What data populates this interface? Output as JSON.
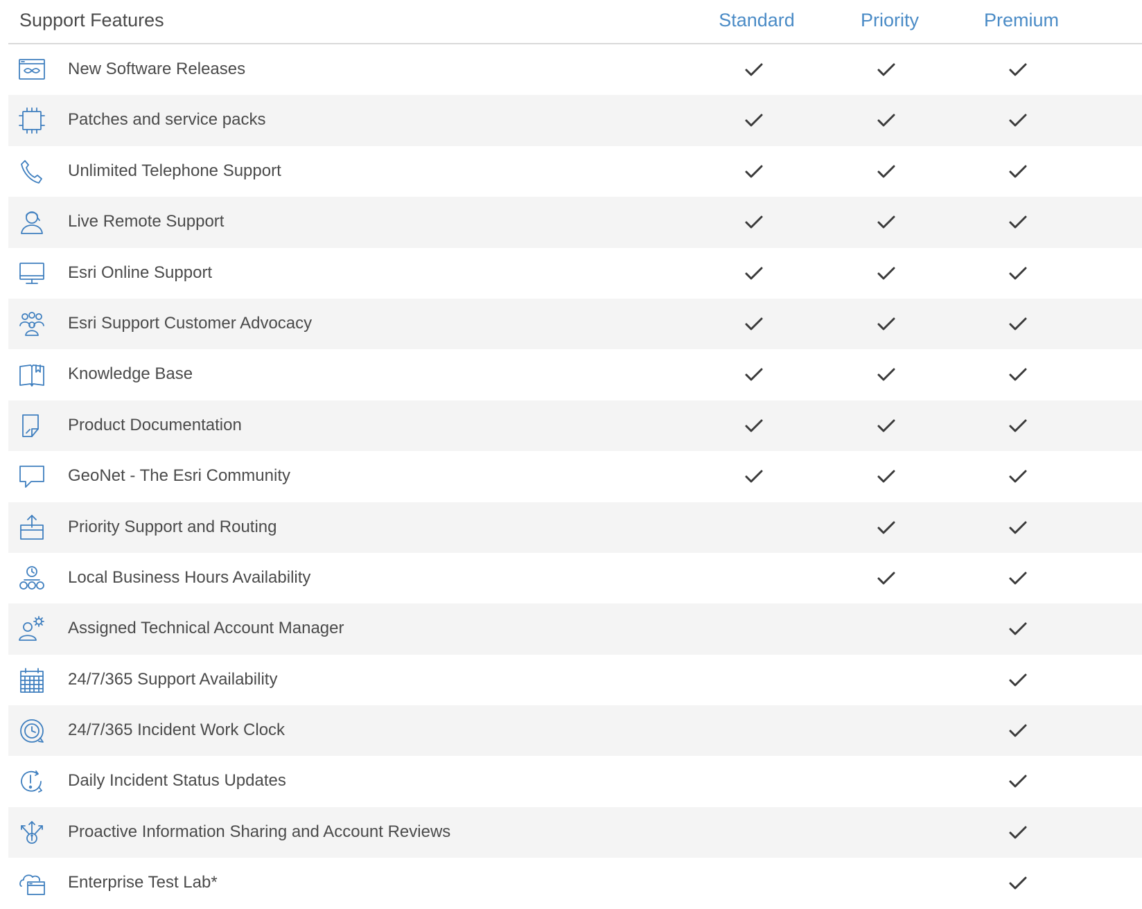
{
  "header": {
    "title": "Support Features",
    "tiers": [
      "Standard",
      "Priority",
      "Premium"
    ]
  },
  "colors": {
    "tier_header": "#4a8bc6",
    "icon": "#3f7fbf",
    "check": "#3a3a3a",
    "row_alt": "#f4f4f4"
  },
  "rows": [
    {
      "icon": "software-release-icon",
      "label": "New Software Releases",
      "standard": true,
      "priority": true,
      "premium": true
    },
    {
      "icon": "patch-chip-icon",
      "label": "Patches and service packs",
      "standard": true,
      "priority": true,
      "premium": true
    },
    {
      "icon": "telephone-icon",
      "label": "Unlimited Telephone Support",
      "standard": true,
      "priority": true,
      "premium": true
    },
    {
      "icon": "remote-support-icon",
      "label": "Live Remote Support",
      "standard": true,
      "priority": true,
      "premium": true
    },
    {
      "icon": "monitor-icon",
      "label": "Esri Online Support",
      "standard": true,
      "priority": true,
      "premium": true
    },
    {
      "icon": "customer-group-icon",
      "label": "Esri Support Customer Advocacy",
      "standard": true,
      "priority": true,
      "premium": true
    },
    {
      "icon": "book-icon",
      "label": "Knowledge Base",
      "standard": true,
      "priority": true,
      "premium": true
    },
    {
      "icon": "document-icon",
      "label": "Product Documentation",
      "standard": true,
      "priority": true,
      "premium": true
    },
    {
      "icon": "speech-bubble-icon",
      "label": "GeoNet - The Esri Community",
      "standard": true,
      "priority": true,
      "premium": true
    },
    {
      "icon": "priority-upload-icon",
      "label": "Priority Support and Routing",
      "standard": false,
      "priority": true,
      "premium": true
    },
    {
      "icon": "business-hours-icon",
      "label": "Local Business Hours Availability",
      "standard": false,
      "priority": true,
      "premium": true
    },
    {
      "icon": "account-manager-icon",
      "label": "Assigned Technical Account Manager",
      "standard": false,
      "priority": false,
      "premium": true
    },
    {
      "icon": "calendar-icon",
      "label": "24/7/365 Support Availability",
      "standard": false,
      "priority": false,
      "premium": true
    },
    {
      "icon": "work-clock-icon",
      "label": "24/7/365 Incident Work Clock",
      "standard": false,
      "priority": false,
      "premium": true
    },
    {
      "icon": "status-alert-icon",
      "label": "Daily Incident Status Updates",
      "standard": false,
      "priority": false,
      "premium": true
    },
    {
      "icon": "info-sharing-icon",
      "label": "Proactive Information Sharing and Account Reviews",
      "standard": false,
      "priority": false,
      "premium": true
    },
    {
      "icon": "test-lab-icon",
      "label": "Enterprise Test Lab*",
      "standard": false,
      "priority": false,
      "premium": true
    }
  ]
}
